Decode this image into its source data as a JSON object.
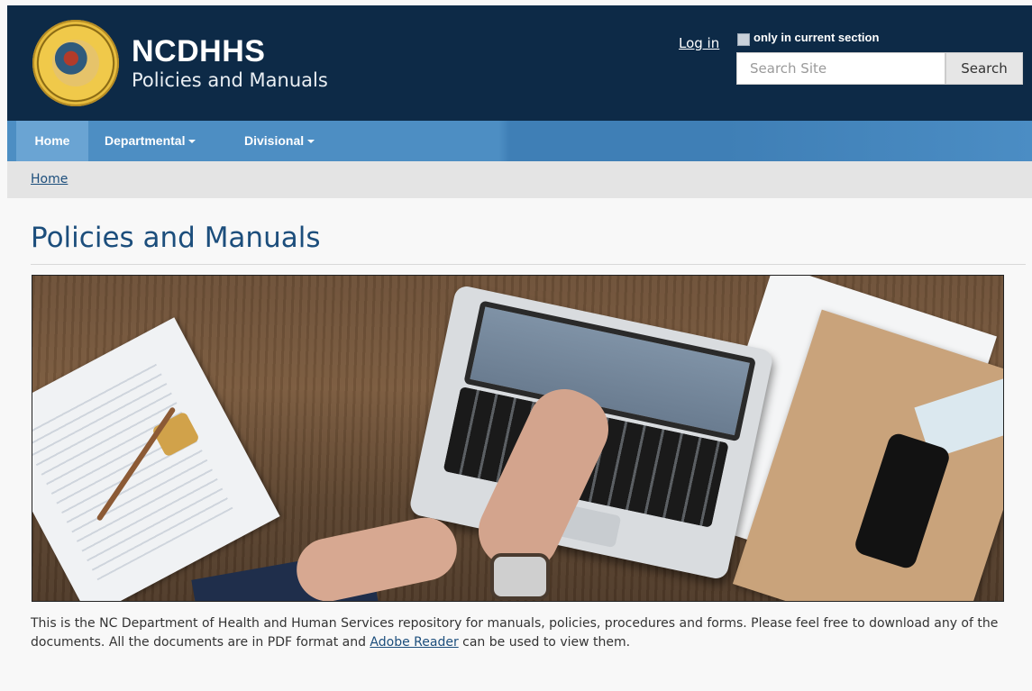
{
  "header": {
    "brand_title": "NCDHHS",
    "brand_subtitle": "Policies and Manuals",
    "login_label": "Log in",
    "section_checkbox_label": "only in current section",
    "search_placeholder": "Search Site",
    "search_button_label": "Search"
  },
  "nav": {
    "items": [
      {
        "label": "Home"
      },
      {
        "label": "Departmental"
      },
      {
        "label": "Divisional"
      }
    ]
  },
  "breadcrumb": {
    "items": [
      {
        "label": "Home"
      }
    ]
  },
  "main": {
    "title": "Policies and Manuals",
    "description_before": "This is the NC Department of Health and Human Services repository for manuals, policies, procedures and forms. Please feel free to download any of the documents. All the documents are in PDF format and ",
    "description_link": "Adobe Reader",
    "description_after": " can be used to view them."
  },
  "colors": {
    "header_bg": "#0d2a47",
    "nav_bg": "#4d8ec3",
    "title_color": "#1c4e7c"
  }
}
